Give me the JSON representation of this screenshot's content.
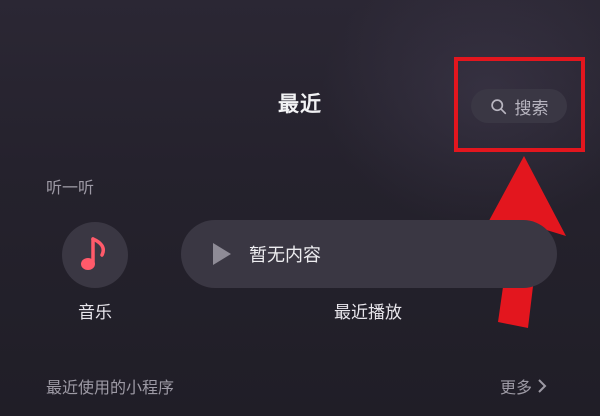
{
  "header": {
    "title": "最近",
    "search_label": "搜索",
    "search_icon": "search-icon"
  },
  "listen_section": {
    "label": "听一听",
    "music": {
      "icon": "music-note-icon",
      "label": "音乐",
      "icon_color": "#ff5a6a"
    },
    "recent_play": {
      "status_text": "暂无内容",
      "label": "最近播放",
      "icon": "play-icon"
    }
  },
  "mini_programs": {
    "label": "最近使用的小程序",
    "more_label": "更多",
    "more_icon": "chevron-right-icon"
  },
  "annotation": {
    "highlight_color": "#e3161e",
    "arrow_icon": "up-arrow-icon"
  }
}
